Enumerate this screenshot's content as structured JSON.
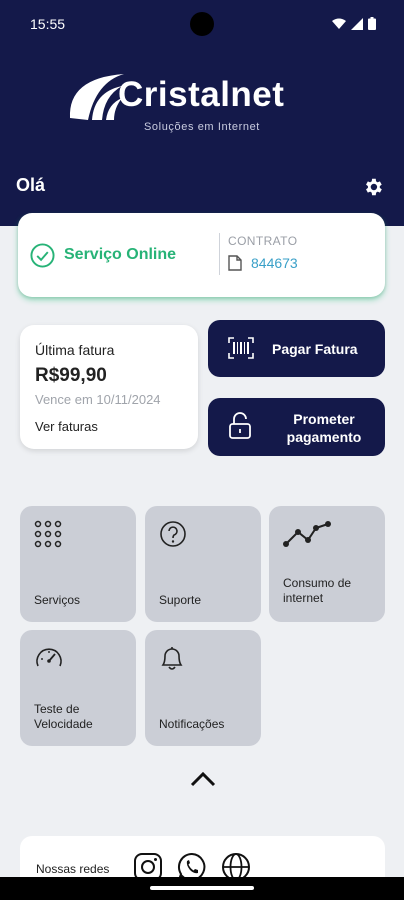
{
  "status_bar": {
    "time": "15:55"
  },
  "brand": {
    "name": "Cristalnet",
    "tagline": "Soluções em Internet"
  },
  "greeting": "Olá",
  "service": {
    "status": "Serviço Online",
    "contract_label": "CONTRATO",
    "contract_number": "844673"
  },
  "invoice": {
    "title": "Última fatura",
    "amount": "R$99,90",
    "due": "Vence em 10/11/2024",
    "link": "Ver faturas"
  },
  "actions": {
    "pay": "Pagar Fatura",
    "promise": "Prometer pagamento"
  },
  "tiles": [
    {
      "label": "Serviços",
      "icon": "grid-dots-icon"
    },
    {
      "label": "Suporte",
      "icon": "question-circle-icon"
    },
    {
      "label": "Consumo de internet",
      "icon": "line-graph-icon"
    },
    {
      "label": "Teste de Velocidade",
      "icon": "speedometer-icon"
    },
    {
      "label": "Notificações",
      "icon": "bell-icon"
    }
  ],
  "social": {
    "label": "Nossas redes",
    "icons": [
      "instagram-icon",
      "whatsapp-icon",
      "globe-icon"
    ]
  },
  "colors": {
    "navy": "#14194a",
    "green": "#27b377",
    "link_blue": "#3aa0c8",
    "tile": "#cbced6"
  }
}
